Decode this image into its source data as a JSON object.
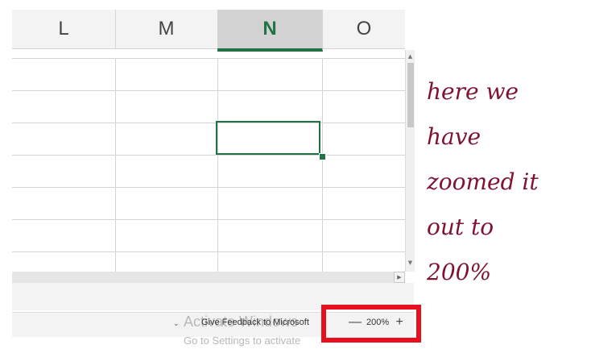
{
  "spreadsheet": {
    "columns": [
      {
        "label": "L",
        "active": false
      },
      {
        "label": "M",
        "active": false
      },
      {
        "label": "N",
        "active": true
      },
      {
        "label": "O",
        "active": false
      }
    ],
    "accent_color": "#217346"
  },
  "status_bar": {
    "dropdown_icon": "chevron-down-icon",
    "feedback_label": "Give Feedback to Microsoft",
    "watermark_line1": "Activate Windows",
    "watermark_line2": "Go to Settings to activate",
    "zoom": {
      "minus": "—",
      "level": "200%",
      "plus": "+"
    }
  },
  "annotation": {
    "lines": [
      "here we",
      "have",
      "zoomed it",
      "out to",
      "200%"
    ],
    "color": "#7e1432",
    "highlight_color": "#e8101f"
  }
}
